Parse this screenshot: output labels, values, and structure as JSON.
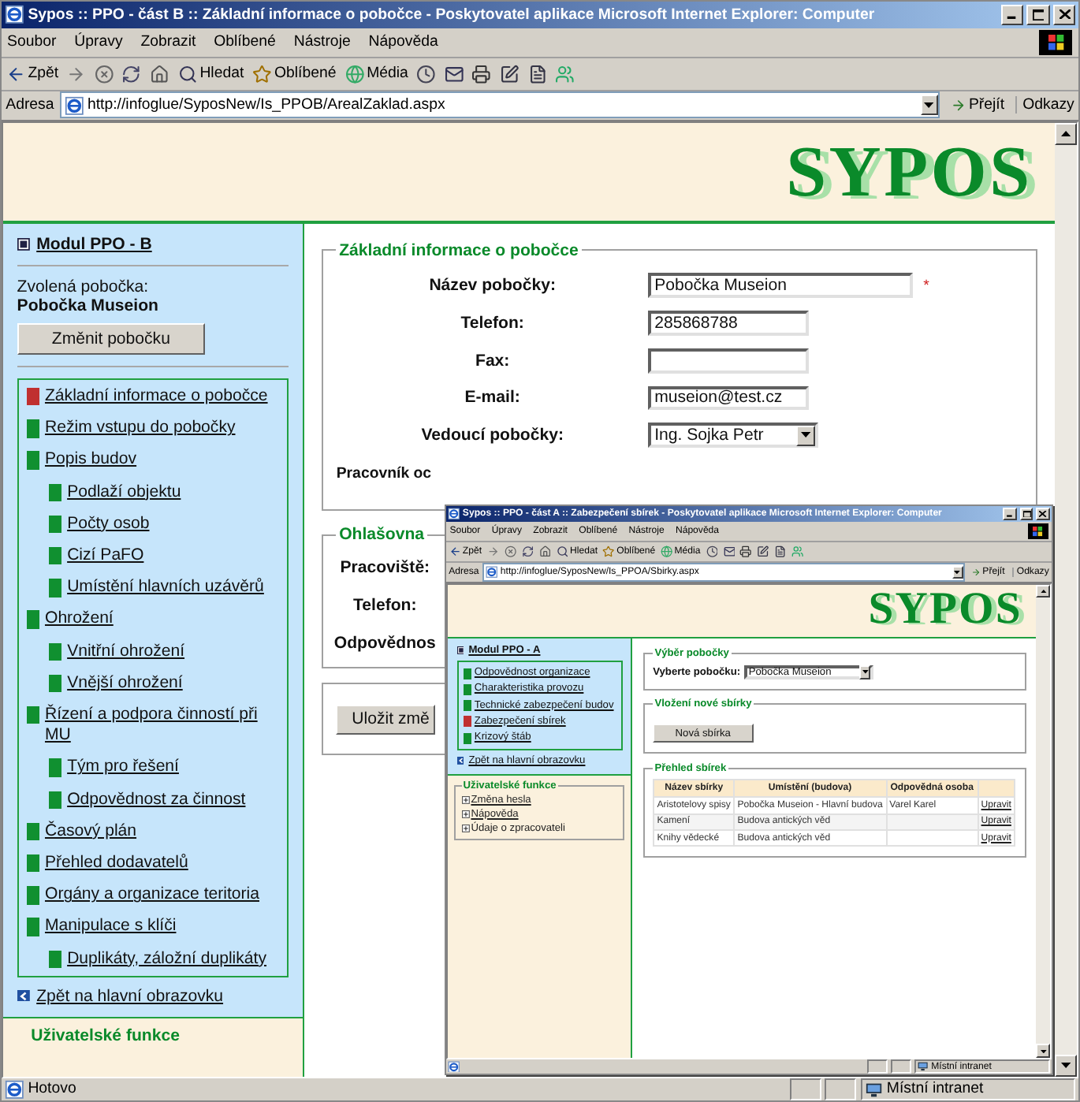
{
  "window": {
    "title": "Sypos :: PPO - část B :: Základní informace o pobočce - Poskytovatel aplikace Microsoft Internet Explorer: Computer",
    "menu": [
      "Soubor",
      "Úpravy",
      "Zobrazit",
      "Oblíbené",
      "Nástroje",
      "Nápověda"
    ],
    "toolbar": [
      {
        "kind": "back",
        "label": "Zpět"
      },
      {
        "kind": "forward"
      },
      {
        "kind": "stop"
      },
      {
        "kind": "refresh"
      },
      {
        "kind": "home"
      },
      {
        "kind": "search",
        "label": "Hledat"
      },
      {
        "kind": "favorites",
        "label": "Oblíbené"
      },
      {
        "kind": "media",
        "label": "Média"
      },
      {
        "kind": "history"
      },
      {
        "kind": "mail"
      },
      {
        "kind": "print"
      },
      {
        "kind": "edit"
      },
      {
        "kind": "discuss"
      },
      {
        "kind": "messenger"
      }
    ],
    "address": {
      "label": "Adresa",
      "url": "http://infoglue/SyposNew/Is_PPOB/ArealZaklad.aspx",
      "go": "Přejít",
      "links": "Odkazy"
    },
    "status": {
      "text": "Hotovo",
      "zone": "Místní intranet"
    }
  },
  "page": {
    "logo": "SYPOS",
    "sidebar": {
      "module": "Modul PPO - B",
      "branch_label": "Zvolená pobočka:",
      "branch": "Pobočka Museion",
      "change_button": "Změnit pobočku",
      "nav": [
        {
          "label": "Základní informace o pobočce",
          "selected": true
        },
        {
          "label": "Režim vstupu do pobočky",
          "selected": false
        },
        {
          "label": "Popis budov",
          "selected": false,
          "children": [
            {
              "label": "Podlaží objektu",
              "selected": false
            },
            {
              "label": "Počty osob",
              "selected": false
            },
            {
              "label": "Cizí PaFO",
              "selected": false
            },
            {
              "label": "Umístění hlavních uzávěrů",
              "selected": false
            }
          ]
        },
        {
          "label": "Ohrožení",
          "selected": false,
          "children": [
            {
              "label": "Vnitřní ohrožení",
              "selected": false
            },
            {
              "label": "Vnější ohrožení",
              "selected": false
            }
          ]
        },
        {
          "label": "Řízení a podpora činností při MU",
          "selected": false,
          "children": [
            {
              "label": "Tým pro řešení",
              "selected": false
            },
            {
              "label": "Odpovědnost za činnost",
              "selected": false
            }
          ]
        },
        {
          "label": "Časový plán",
          "selected": false
        },
        {
          "label": "Přehled dodavatelů",
          "selected": false
        },
        {
          "label": "Orgány a organizace teritoria",
          "selected": false
        },
        {
          "label": "Manipulace s klíči",
          "selected": false,
          "children": [
            {
              "label": "Duplikáty, záložní duplikáty",
              "selected": false
            }
          ]
        }
      ],
      "back": "Zpět na hlavní obrazovku",
      "user_functions": "Uživatelské funkce"
    },
    "form": {
      "legend": "Základní informace o pobočce",
      "fields": [
        {
          "kind": "text",
          "label": "Název pobočky:",
          "value": "Pobočka Museion",
          "required_mark": "*"
        },
        {
          "kind": "text",
          "label": "Telefon:",
          "value": "285868788"
        },
        {
          "kind": "text",
          "label": "Fax:"
        },
        {
          "kind": "text",
          "label": "E-mail:",
          "value": "museion@test.cz"
        },
        {
          "kind": "select",
          "label": "Vedoucí pobočky:",
          "value": "Ing. Sojka Petr"
        }
      ],
      "cut_label": "Pracovník oc"
    },
    "section2": {
      "legend": "Ohlašovna",
      "labels": [
        "Pracoviště:",
        "Telefon:",
        "Odpovědnos"
      ]
    },
    "save_button": "Uložit změ"
  },
  "popup_window": {
    "title": "Sypos :: PPO - část A :: Zabezpečení sbírek - Poskytovatel aplikace Microsoft Internet Explorer: Computer",
    "menu": [
      "Soubor",
      "Úpravy",
      "Zobrazit",
      "Oblíbené",
      "Nástroje",
      "Nápověda"
    ],
    "toolbar": [
      {
        "kind": "back",
        "label": "Zpět"
      },
      {
        "kind": "forward"
      },
      {
        "kind": "stop"
      },
      {
        "kind": "refresh"
      },
      {
        "kind": "home"
      },
      {
        "kind": "search",
        "label": "Hledat"
      },
      {
        "kind": "favorites",
        "label": "Oblíbené"
      },
      {
        "kind": "media",
        "label": "Média"
      },
      {
        "kind": "history"
      },
      {
        "kind": "mail"
      },
      {
        "kind": "print"
      },
      {
        "kind": "edit"
      },
      {
        "kind": "discuss"
      },
      {
        "kind": "messenger"
      }
    ],
    "address": {
      "label": "Adresa",
      "url": "http://infoglue/SyposNew/Is_PPOA/Sbirky.aspx",
      "go": "Přejít",
      "links": "Odkazy"
    },
    "status": {
      "zone": "Místní intranet"
    },
    "page": {
      "logo": "SYPOS",
      "sidebar": {
        "module": "Modul PPO - A",
        "nav": [
          {
            "label": "Odpovědnost organizace",
            "selected": false
          },
          {
            "label": "Charakteristika provozu",
            "selected": false
          },
          {
            "label": "Technické zabezpečení budov",
            "selected": false
          },
          {
            "label": "Zabezpečení sbírek",
            "selected": true
          },
          {
            "label": "Krizový štáb",
            "selected": false
          }
        ],
        "back": "Zpět na hlavní obrazovku",
        "user_functions": {
          "legend": "Uživatelské funkce",
          "items": [
            {
              "label": "Změna hesla",
              "link": true
            },
            {
              "label": "Nápověda",
              "link": true
            },
            {
              "label": "Údaje o zpracovateli",
              "link": false
            }
          ]
        }
      },
      "branch_select": {
        "legend": "Výběr pobočky",
        "label": "Vyberte pobočku:",
        "value": "Pobočka Museion"
      },
      "new_item": {
        "legend": "Vložení nové sbírky",
        "button": "Nová sbírka"
      },
      "table": {
        "legend": "Přehled sbírek",
        "columns": [
          "Název sbírky",
          "Umístění (budova)",
          "Odpovědná osoba"
        ],
        "rows": [
          {
            "cells": [
              "Aristotelovy spisy",
              "Pobočka Museion - Hlavní budova",
              "Varel Karel"
            ],
            "action": "Upravit"
          },
          {
            "cells": [
              "Kamení",
              "Budova antických věd",
              ""
            ],
            "action": "Upravit"
          },
          {
            "cells": [
              "Knihy vědecké",
              "Budova antických věd",
              ""
            ],
            "action": "Upravit"
          }
        ]
      }
    }
  }
}
